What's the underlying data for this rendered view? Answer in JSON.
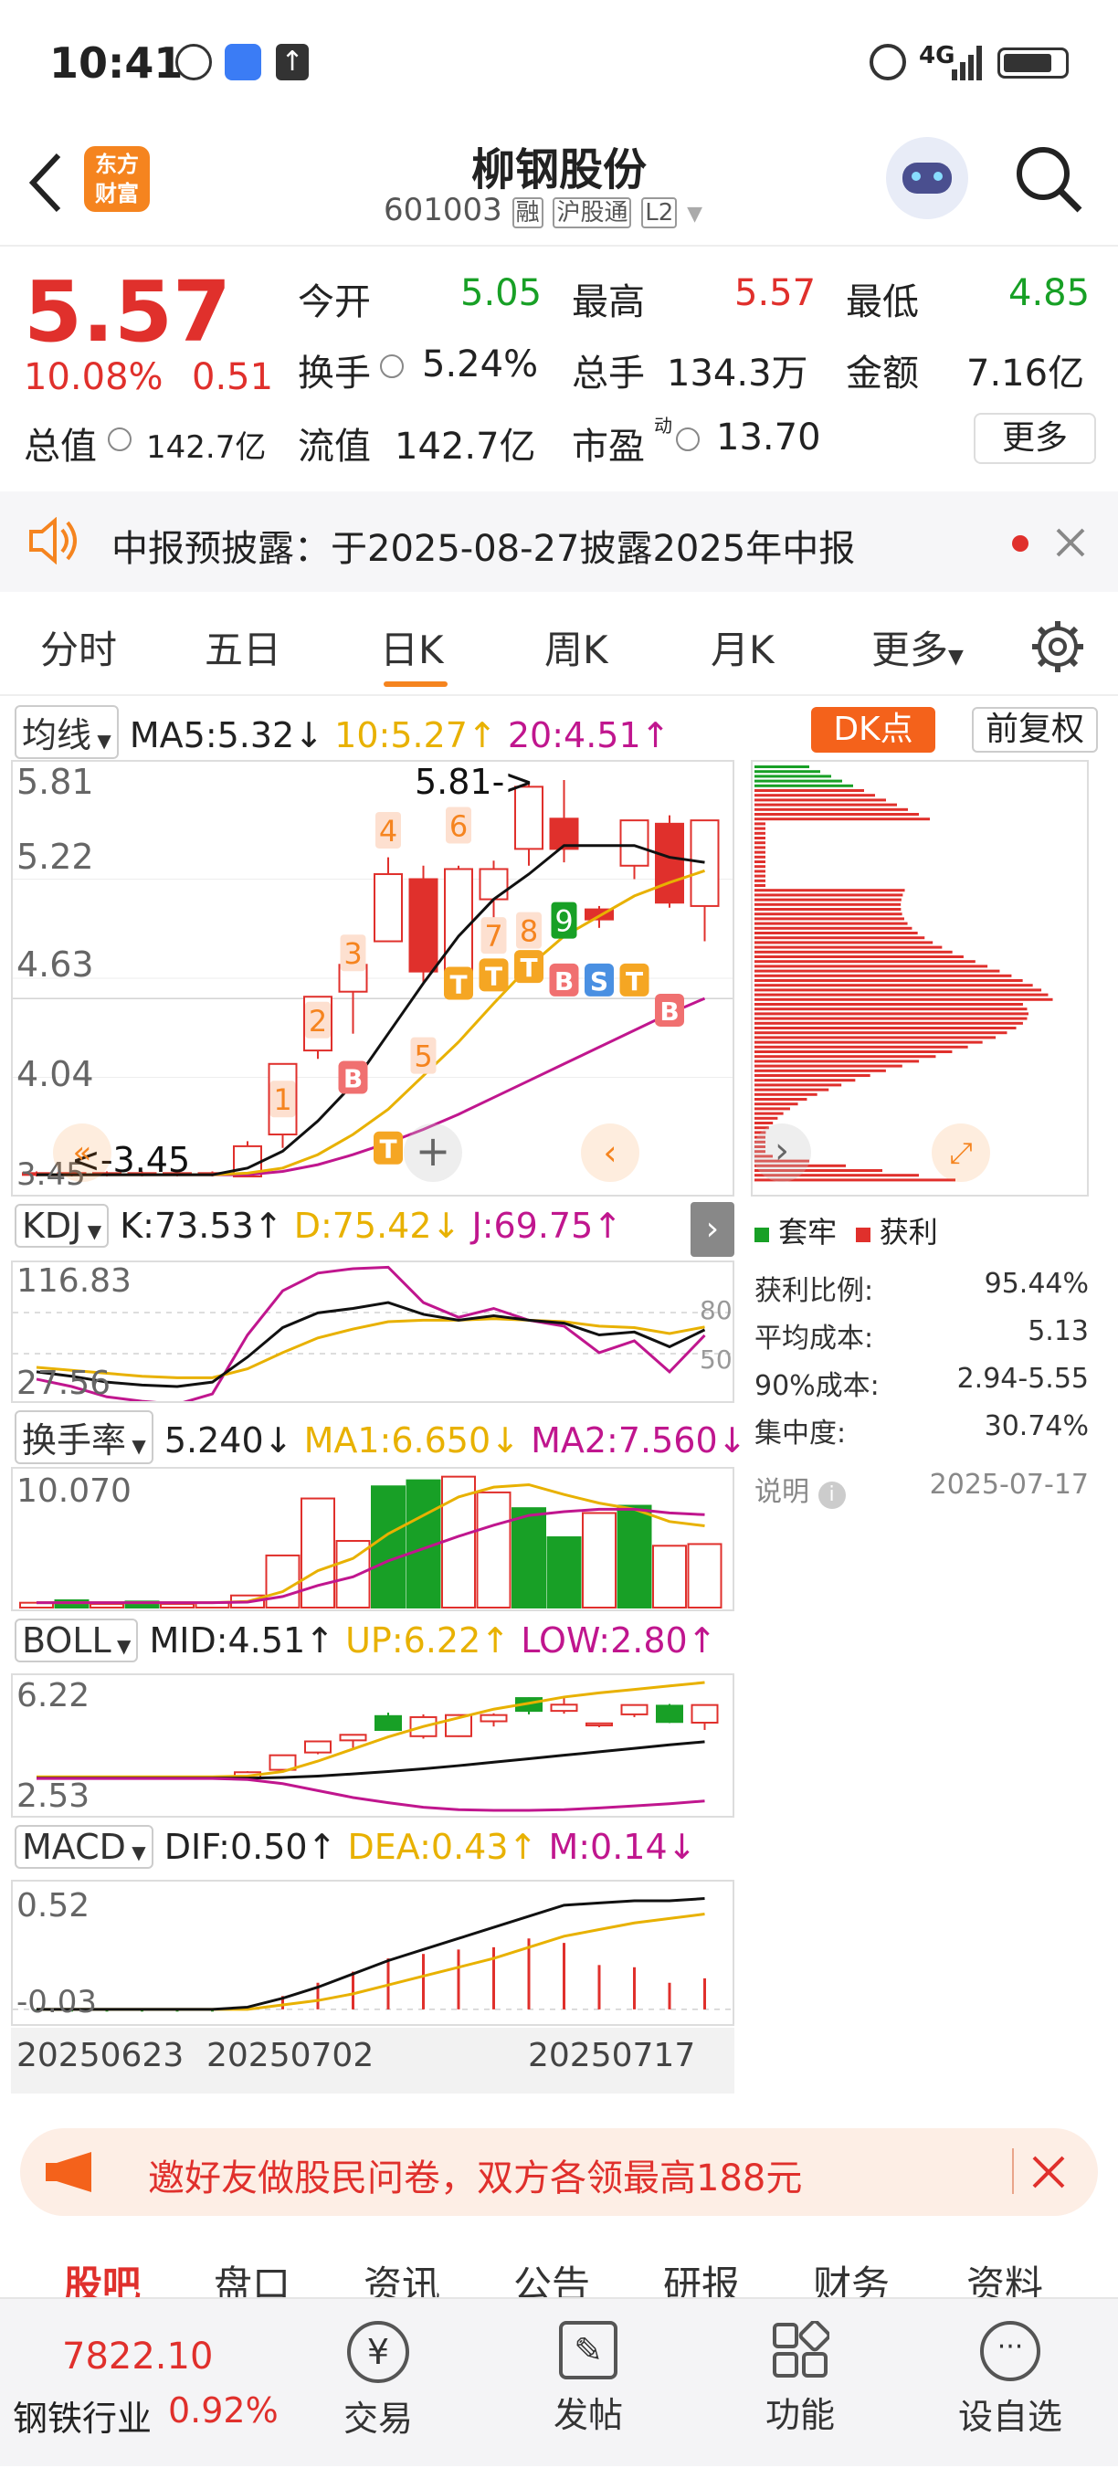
{
  "status": {
    "time": "10:41",
    "network": "4G"
  },
  "header": {
    "title": "柳钢股份",
    "code": "601003",
    "tag1": "融",
    "tag2": "沪股通",
    "tag3": "L2",
    "back_label": "<",
    "logo_line1": "东方",
    "logo_line2": "财富"
  },
  "quote": {
    "price": "5.57",
    "change_pct": "10.08%",
    "change": "0.51",
    "open_label": "今开",
    "open": "5.05",
    "high_label": "最高",
    "high": "5.57",
    "low_label": "最低",
    "low": "4.85",
    "turnover_label": "换手",
    "turnover": "5.24%",
    "volume_label": "总手",
    "volume": "134.3万",
    "amount_label": "金额",
    "amount": "7.16亿",
    "mktcap_label": "总值",
    "mktcap": "142.7亿",
    "float_label": "流值",
    "float": "142.7亿",
    "pe_label": "市盈",
    "pe_sup": "动",
    "pe": "13.70",
    "more_label": "更多"
  },
  "notice": {
    "text": "中报预披露：于2025-08-27披露2025年中报"
  },
  "tabs": [
    "分时",
    "五日",
    "日K",
    "周K",
    "月K",
    "更多"
  ],
  "active_tab": "日K",
  "ma_legend": {
    "selector": "均线",
    "ma5": "MA5:5.32↓",
    "ma10": "10:5.27↑",
    "ma20": "20:4.51↑",
    "dk": "DK点",
    "adjust": "前复权"
  },
  "kline_axis": [
    "5.81",
    "5.22",
    "4.63",
    "4.04",
    "3.45"
  ],
  "kline_annot": {
    "high": "5.81->",
    "low": "<-3.45"
  },
  "kline_signals": {
    "seq": [
      "1",
      "2",
      "3",
      "4",
      "5",
      "6",
      "7",
      "8",
      "9"
    ],
    "T": "T",
    "B": "B",
    "S": "S"
  },
  "candles": [
    {
      "o": 3.46,
      "c": 3.47,
      "h": 3.48,
      "l": 3.45
    },
    {
      "o": 3.47,
      "c": 3.46,
      "h": 3.48,
      "l": 3.45
    },
    {
      "o": 3.46,
      "c": 3.47,
      "h": 3.48,
      "l": 3.45
    },
    {
      "o": 3.47,
      "c": 3.46,
      "h": 3.48,
      "l": 3.45
    },
    {
      "o": 3.46,
      "c": 3.47,
      "h": 3.48,
      "l": 3.45
    },
    {
      "o": 3.47,
      "c": 3.46,
      "h": 3.48,
      "l": 3.45
    },
    {
      "o": 3.45,
      "c": 3.63,
      "h": 3.66,
      "l": 3.45
    },
    {
      "o": 3.7,
      "c": 4.12,
      "h": 4.12,
      "l": 3.62
    },
    {
      "o": 4.2,
      "c": 4.52,
      "h": 4.52,
      "l": 4.15
    },
    {
      "o": 4.55,
      "c": 4.71,
      "h": 4.73,
      "l": 4.3
    },
    {
      "o": 4.85,
      "c": 5.25,
      "h": 5.35,
      "l": 4.85
    },
    {
      "o": 5.22,
      "c": 4.67,
      "h": 5.3,
      "l": 4.6
    },
    {
      "o": 4.67,
      "c": 5.28,
      "h": 5.3,
      "l": 4.65
    },
    {
      "o": 5.1,
      "c": 5.28,
      "h": 5.33,
      "l": 4.95
    },
    {
      "o": 5.4,
      "c": 5.77,
      "h": 5.79,
      "l": 5.3
    },
    {
      "o": 5.58,
      "c": 5.4,
      "h": 5.81,
      "l": 5.32
    },
    {
      "o": 5.04,
      "c": 4.98,
      "h": 5.06,
      "l": 4.93
    },
    {
      "o": 5.3,
      "c": 5.57,
      "h": 5.57,
      "l": 5.22
    },
    {
      "o": 5.55,
      "c": 5.08,
      "h": 5.6,
      "l": 5.05
    },
    {
      "o": 5.06,
      "c": 5.57,
      "h": 5.57,
      "l": 4.85
    }
  ],
  "ma_lines": {
    "ma5": [
      3.46,
      3.46,
      3.46,
      3.46,
      3.46,
      3.46,
      3.5,
      3.6,
      3.78,
      4.0,
      4.3,
      4.6,
      4.88,
      5.1,
      5.25,
      5.42,
      5.42,
      5.42,
      5.35,
      5.32
    ],
    "ma10": [
      3.46,
      3.46,
      3.46,
      3.46,
      3.46,
      3.46,
      3.47,
      3.5,
      3.58,
      3.7,
      3.85,
      4.05,
      4.25,
      4.48,
      4.7,
      4.88,
      5.0,
      5.12,
      5.2,
      5.27
    ],
    "ma20": [
      3.46,
      3.46,
      3.46,
      3.46,
      3.46,
      3.46,
      3.46,
      3.48,
      3.52,
      3.58,
      3.65,
      3.73,
      3.82,
      3.92,
      4.02,
      4.12,
      4.22,
      4.32,
      4.42,
      4.51
    ]
  },
  "chip": {
    "legend_trapped": "套牢",
    "legend_profit": "获利",
    "rows": [
      {
        "label": "获利比例:",
        "value": "95.44%"
      },
      {
        "label": "平均成本:",
        "value": "5.13"
      },
      {
        "label": "90%成本:",
        "value": "2.94-5.55"
      },
      {
        "label": "集中度:",
        "value": "30.74%"
      }
    ],
    "note_label": "说明",
    "date": "2025-07-17"
  },
  "kdj": {
    "selector": "KDJ",
    "k": "K:73.53↑",
    "d": "D:75.42↓",
    "j": "J:69.75↑",
    "axis_top": "116.83",
    "axis_bottom": "27.56",
    "ref80": "80",
    "ref50": "50",
    "k_vals": [
      45,
      42,
      38,
      36,
      35,
      38,
      55,
      75,
      85,
      88,
      92,
      84,
      80,
      83,
      80,
      78,
      70,
      72,
      62,
      73.5
    ],
    "d_vals": [
      48,
      46,
      44,
      42,
      41,
      41,
      47,
      58,
      68,
      74,
      79,
      80,
      80,
      81,
      80,
      79,
      76,
      75,
      71,
      75.4
    ],
    "j_vals": [
      40,
      35,
      28,
      25,
      23,
      30,
      70,
      100,
      112,
      115,
      116,
      92,
      82,
      88,
      80,
      76,
      58,
      66,
      45,
      69.75
    ]
  },
  "turnover": {
    "selector": "换手率",
    "value": "5.240↓",
    "ma1": "MA1:6.650↓",
    "ma2": "MA2:7.560↓",
    "axis_top": "10.070",
    "bars": [
      {
        "v": 0.4,
        "up": true
      },
      {
        "v": 0.6,
        "up": false
      },
      {
        "v": 0.3,
        "up": true
      },
      {
        "v": 0.5,
        "up": false
      },
      {
        "v": 0.3,
        "up": true
      },
      {
        "v": 0.4,
        "up": true
      },
      {
        "v": 1.0,
        "up": true
      },
      {
        "v": 4.3,
        "up": true
      },
      {
        "v": 9.0,
        "up": true
      },
      {
        "v": 5.5,
        "up": true
      },
      {
        "v": 10.0,
        "up": false
      },
      {
        "v": 10.5,
        "up": false
      },
      {
        "v": 10.8,
        "up": true
      },
      {
        "v": 9.5,
        "up": true
      },
      {
        "v": 8.2,
        "up": false
      },
      {
        "v": 5.8,
        "up": false
      },
      {
        "v": 7.8,
        "up": true
      },
      {
        "v": 8.4,
        "up": false
      },
      {
        "v": 5.1,
        "up": true
      },
      {
        "v": 5.24,
        "up": true
      }
    ]
  },
  "boll": {
    "selector": "BOLL",
    "mid": "MID:4.51↑",
    "up": "UP:6.22↑",
    "low": "LOW:2.80↑",
    "axis_top": "6.22",
    "axis_bottom": "2.53"
  },
  "macd": {
    "selector": "MACD",
    "dif": "DIF:0.50↑",
    "dea": "DEA:0.43↑",
    "m": "M:0.14↓",
    "axis_top": "0.52",
    "axis_bottom": "-0.03",
    "m_vals": [
      -0.01,
      -0.01,
      -0.01,
      -0.01,
      -0.01,
      -0.01,
      0.01,
      0.06,
      0.12,
      0.17,
      0.23,
      0.25,
      0.27,
      0.28,
      0.32,
      0.3,
      0.2,
      0.19,
      0.12,
      0.14
    ]
  },
  "dates": [
    "20250623",
    "20250702",
    "20250717"
  ],
  "banner": {
    "text": "邀好友做股民问卷，双方各领最高188元"
  },
  "subtabs": [
    "股吧",
    "盘口",
    "资讯",
    "公告",
    "研报",
    "财务",
    "资料"
  ],
  "bottom": {
    "index_value": "7822.10",
    "index_name": "钢铁行业",
    "index_pct": "0.92%",
    "trade": "交易",
    "post": "发帖",
    "func": "功能",
    "watch": "设自选"
  },
  "colors": {
    "up": "#e0302c",
    "down": "#18a026",
    "ma10": "#e8b100",
    "ma20": "#c0168e",
    "accent": "#f5841f"
  }
}
